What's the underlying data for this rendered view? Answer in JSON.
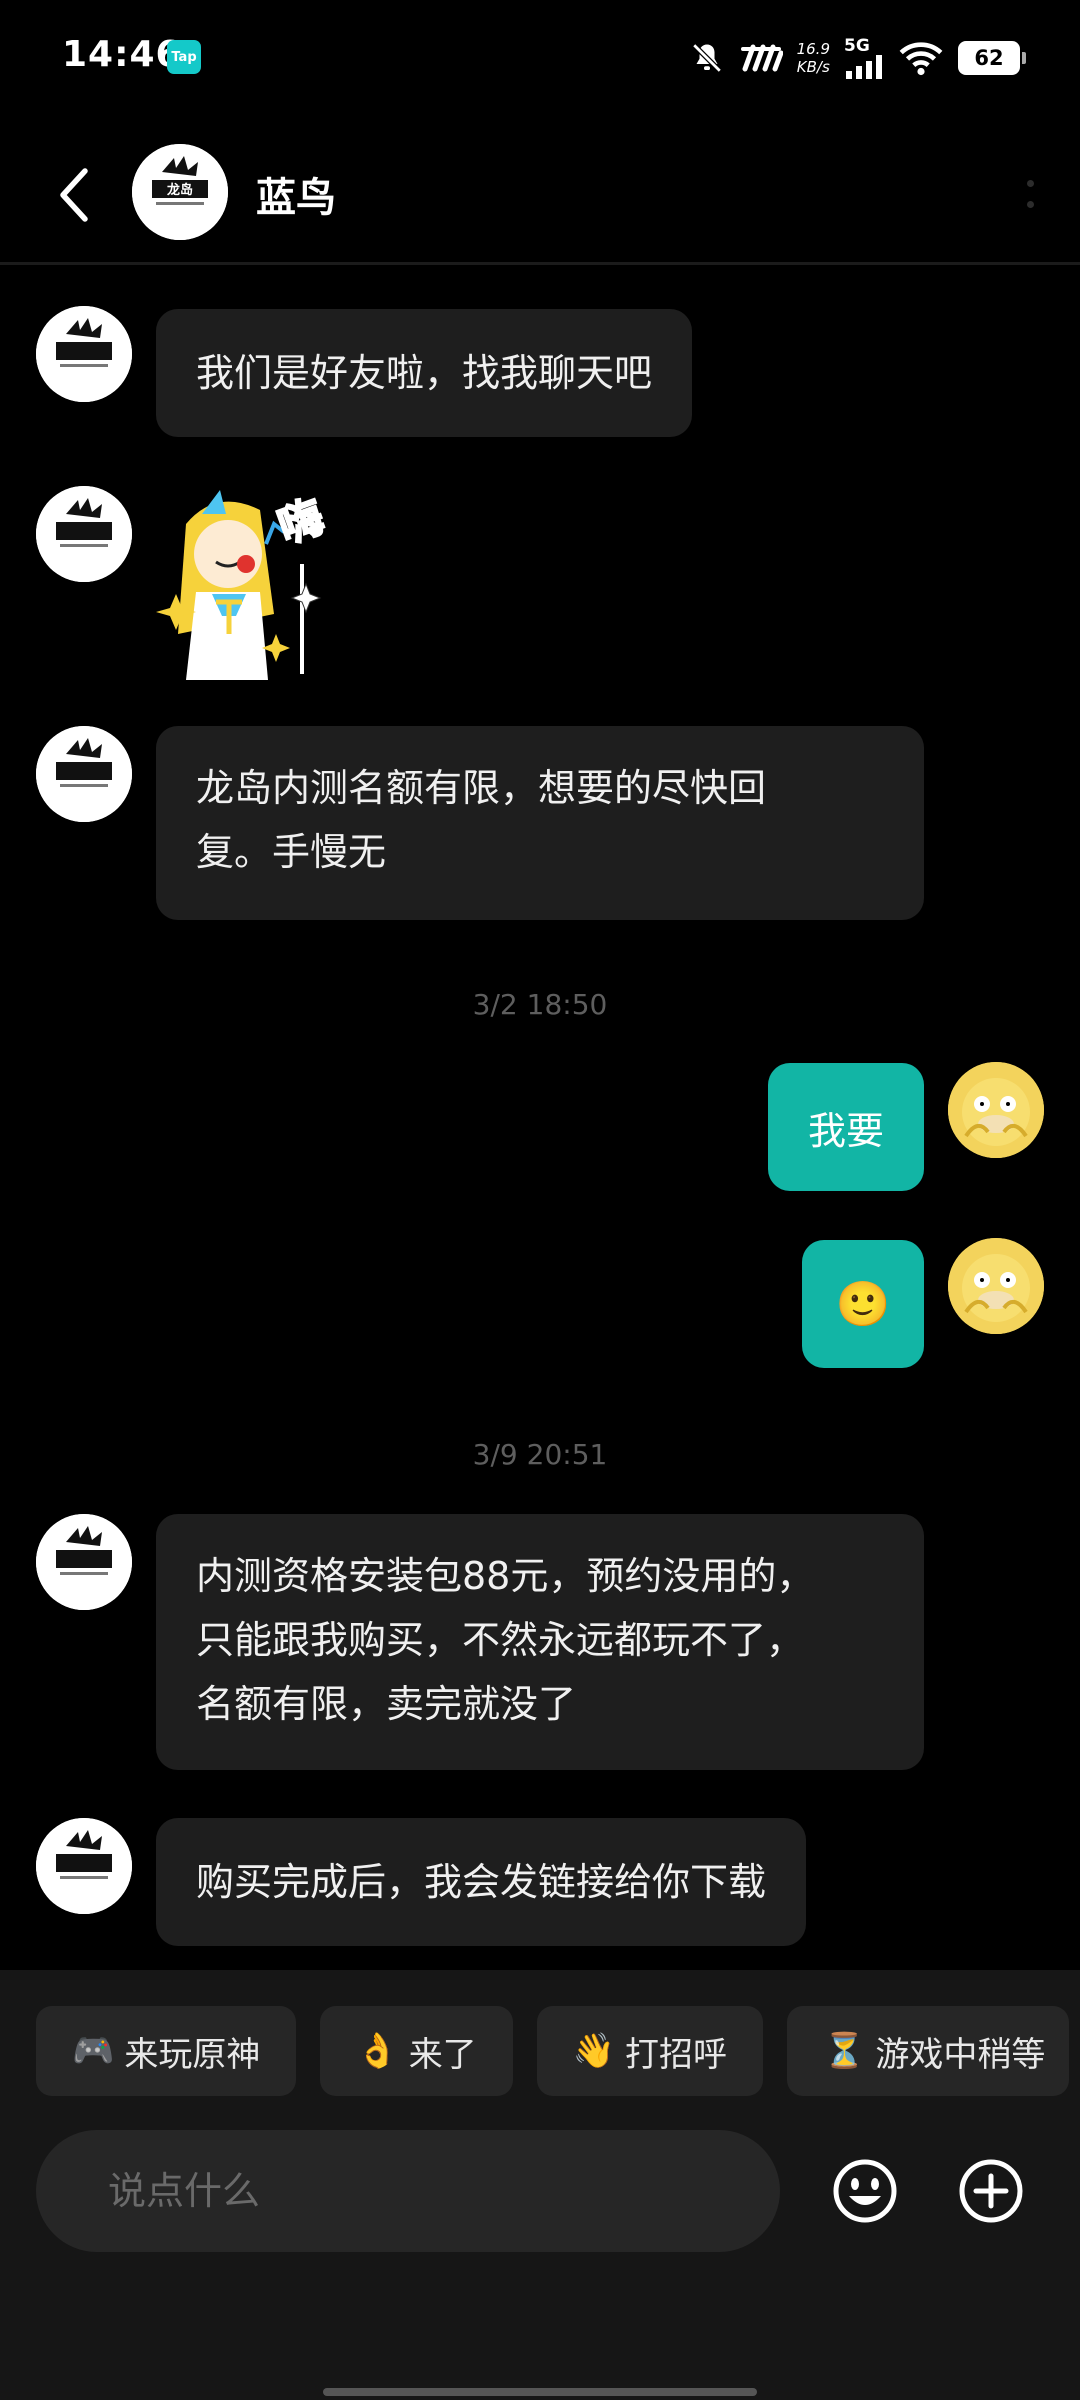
{
  "status_bar": {
    "time": "14:46",
    "tap_badge": "Tap",
    "net_speed_value": "16.9",
    "net_speed_unit": "KB/s",
    "network": "5G",
    "battery": "62",
    "icons": [
      "mute-bell-icon",
      "signal-icon",
      "wifi-icon",
      "battery-icon"
    ]
  },
  "header": {
    "back_icon": "chevron-left-icon",
    "contact_name": "蓝鸟",
    "more_icon": "vertical-dots-icon"
  },
  "messages": [
    {
      "sender": "contact",
      "type": "text",
      "text": "我们是好友啦，找我聊天吧"
    },
    {
      "sender": "contact",
      "type": "sticker",
      "sticker_text": "嗨"
    },
    {
      "sender": "contact",
      "type": "text",
      "lines": [
        "龙岛内测名额有限，想要的尽快回",
        "复。手慢无"
      ]
    },
    {
      "type": "timestamp",
      "text": "3/2  18:50"
    },
    {
      "sender": "me",
      "type": "text",
      "text": "我要"
    },
    {
      "sender": "me",
      "type": "emoji",
      "text": "🙂"
    },
    {
      "type": "timestamp",
      "text": "3/9  20:51"
    },
    {
      "sender": "contact",
      "type": "text",
      "lines": [
        "内测资格安装包88元，预约没用的，",
        "只能跟我购买，不然永远都玩不了，",
        "名额有限，卖完就没了"
      ]
    },
    {
      "sender": "contact",
      "type": "text",
      "text": "购买完成后，我会发链接给你下载"
    }
  ],
  "quick_replies": [
    {
      "icon": "🎮",
      "label": "来玩原神"
    },
    {
      "icon": "👌",
      "label": "来了"
    },
    {
      "icon": "👋",
      "label": "打招呼"
    },
    {
      "icon": "⏳",
      "label": "游戏中稍等"
    }
  ],
  "composer": {
    "placeholder": "说点什么",
    "value": "",
    "emoji_icon": "smiley-face-icon",
    "plus_icon": "plus-circle-icon"
  },
  "colors": {
    "background": "#000000",
    "bubble_contact": "#1e1e1e",
    "bubble_me": "#12b5a5",
    "accent": "#14c9c9"
  }
}
